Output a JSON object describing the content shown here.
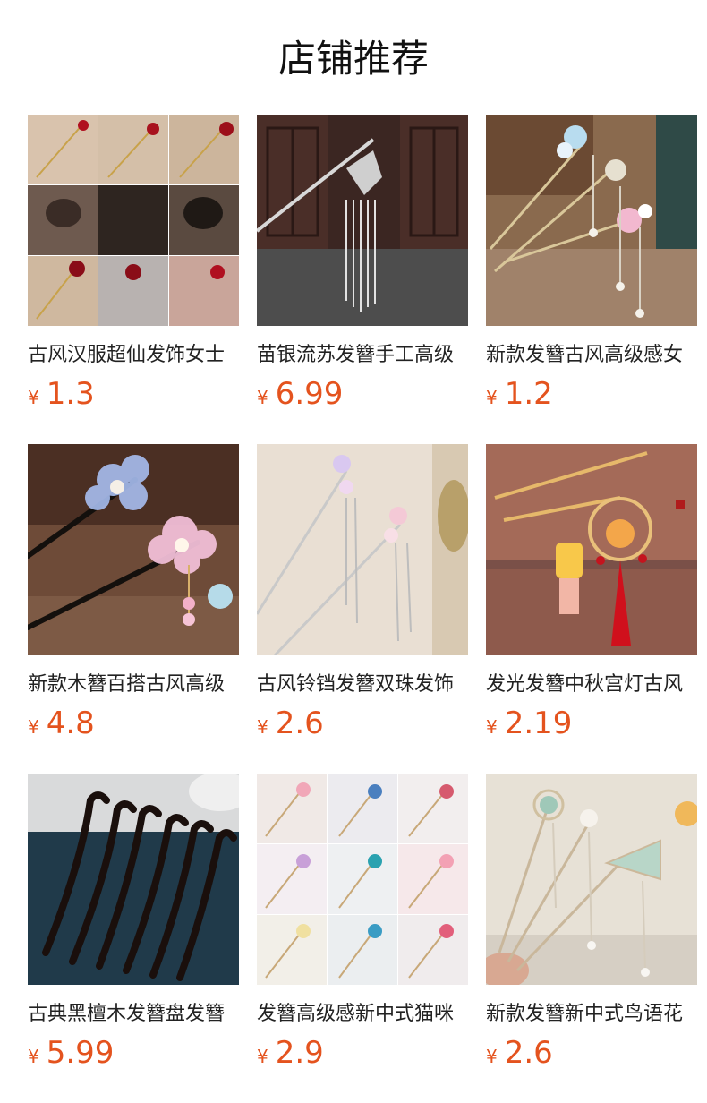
{
  "header": {
    "title": "店铺推荐"
  },
  "currency": "¥",
  "colors": {
    "price": "#e4531e"
  },
  "products": [
    {
      "name": "古风汉服超仙发饰女士",
      "price": "1.3",
      "image": "collage-hairpins-red-flowers"
    },
    {
      "name": "苗银流苏发簪手工高级",
      "price": "6.99",
      "image": "silver-tassel-hairpin"
    },
    {
      "name": "新款发簪古风高级感女",
      "price": "1.2",
      "image": "flower-tassel-hairpins"
    },
    {
      "name": "新款木簪百搭古风高级",
      "price": "4.8",
      "image": "wood-flower-hairpins"
    },
    {
      "name": "古风铃铛发簪双珠发饰",
      "price": "2.6",
      "image": "silver-bell-hairpins"
    },
    {
      "name": "发光发簪中秋宫灯古风",
      "price": "2.19",
      "image": "lantern-hairpins"
    },
    {
      "name": "古典黑檀木发簪盘发簪",
      "price": "5.99",
      "image": "ebony-hairpins"
    },
    {
      "name": "发簪高级感新中式猫咪",
      "price": "2.9",
      "image": "collage-cat-hairpins"
    },
    {
      "name": "新款发簪新中式鸟语花",
      "price": "2.6",
      "image": "fan-bird-hairpins"
    }
  ]
}
